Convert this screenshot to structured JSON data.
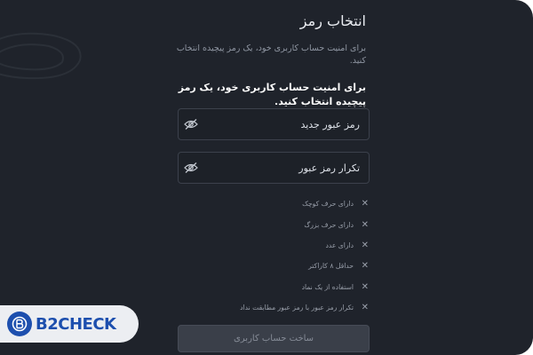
{
  "header": {
    "title": "انتخاب رمز",
    "subtitle": "برای امنیت حساب کاربری خود، یک رمز پیچیده انتخاب کنید."
  },
  "form": {
    "instruction": "برای امنیت حساب کاربری خود، یک رمز پیچیده انتخاب کنید.",
    "new_password_placeholder": "رمز عبور جدید",
    "repeat_password_placeholder": "تکرار رمز عبور",
    "toggle_icon": "eye-slash-icon",
    "rule_status_icon": "close-x-icon",
    "rules": [
      "دارای حرف کوچک",
      "دارای حرف بزرگ",
      "دارای عدد",
      "حداقل ۸ کاراکتر",
      "استفاده از یک نماد",
      "تکرار رمز عبور با رمز عبور مطابقت نداد"
    ],
    "submit_label": "ساخت حساب کاربری"
  },
  "watermark": {
    "brand": "B2CHECK",
    "icon": "b2check-logo-icon"
  },
  "colors": {
    "background": "#1f232b",
    "field_border": "#3c414c",
    "text_primary": "#e9ecf1",
    "text_muted": "#9aa0ab",
    "button_disabled": "#3a3f49",
    "brand": "#1d4fae"
  }
}
